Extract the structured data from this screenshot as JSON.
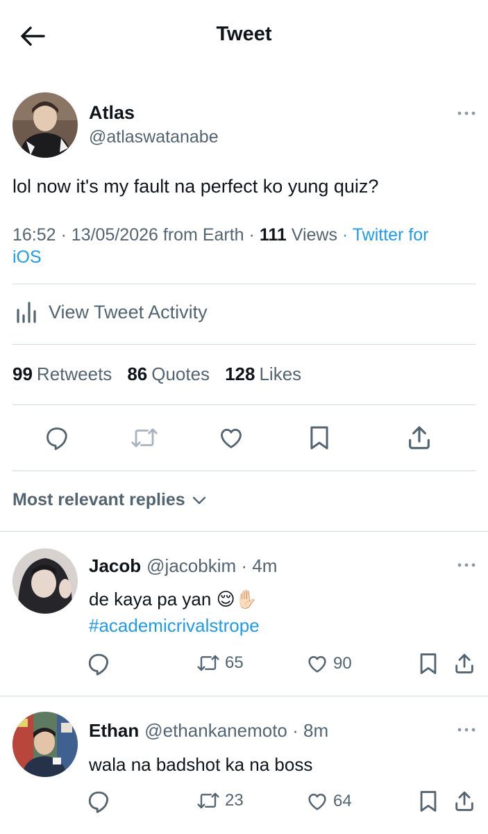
{
  "header": {
    "title": "Tweet"
  },
  "tweet": {
    "author_name": "Atlas",
    "author_handle": "@atlaswatanabe",
    "text": "lol now it's my fault na perfect ko yung quiz?",
    "time": "16:52",
    "date": "13/05/2026",
    "location": "from Earth",
    "views_count": "111",
    "views_label": "Views",
    "source_line1": "Twitter for",
    "source_line2": "iOS",
    "separator": "·"
  },
  "activity": {
    "label": "View Tweet Activity"
  },
  "stats": {
    "retweets_count": "99",
    "retweets_label": "Retweets",
    "quotes_count": "86",
    "quotes_label": "Quotes",
    "likes_count": "128",
    "likes_label": "Likes"
  },
  "replies_sort": {
    "label": "Most relevant replies"
  },
  "replies": [
    {
      "name": "Jacob",
      "handle": "@jacobkim",
      "time": "· 4m",
      "text": "de kaya pa yan 😌✋🏻",
      "hashtag": "#academicrivalstrope",
      "retweets": "65",
      "likes": "90"
    },
    {
      "name": "Ethan",
      "handle": "@ethankanemoto",
      "time": "· 8m",
      "text": "wala na badshot ka na boss",
      "retweets": "23",
      "likes": "64"
    }
  ],
  "colors": {
    "accent": "#1d9bf0",
    "secondary_text": "#536471",
    "divider": "#cfd9de"
  },
  "icons": [
    "back-arrow-icon",
    "more-icon",
    "bar-chart-icon",
    "reply-icon",
    "retweet-icon",
    "heart-icon",
    "bookmark-icon",
    "share-icon",
    "chevron-down-icon"
  ]
}
